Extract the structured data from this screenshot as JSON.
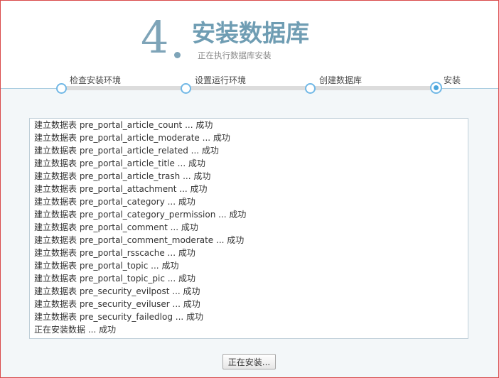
{
  "header": {
    "step_number": "4",
    "title": "安装数据库",
    "subtitle": "正在执行数据库安装"
  },
  "steps": [
    {
      "label": "检查安装环境",
      "state": "done"
    },
    {
      "label": "设置运行环境",
      "state": "done"
    },
    {
      "label": "创建数据库",
      "state": "done"
    },
    {
      "label": "安装",
      "state": "active"
    }
  ],
  "log": {
    "lines": [
      "建立数据表 pre_portal_article_count ... 成功",
      "建立数据表 pre_portal_article_moderate ... 成功",
      "建立数据表 pre_portal_article_related ... 成功",
      "建立数据表 pre_portal_article_title ... 成功",
      "建立数据表 pre_portal_article_trash ... 成功",
      "建立数据表 pre_portal_attachment ... 成功",
      "建立数据表 pre_portal_category ... 成功",
      "建立数据表 pre_portal_category_permission ... 成功",
      "建立数据表 pre_portal_comment ... 成功",
      "建立数据表 pre_portal_comment_moderate ... 成功",
      "建立数据表 pre_portal_rsscache ... 成功",
      "建立数据表 pre_portal_topic ... 成功",
      "建立数据表 pre_portal_topic_pic ... 成功",
      "建立数据表 pre_security_evilpost ... 成功",
      "建立数据表 pre_security_eviluser ... 成功",
      "建立数据表 pre_security_failedlog ... 成功",
      "正在安装数据 ... 成功"
    ]
  },
  "footer": {
    "button_label": "正在安装..."
  }
}
